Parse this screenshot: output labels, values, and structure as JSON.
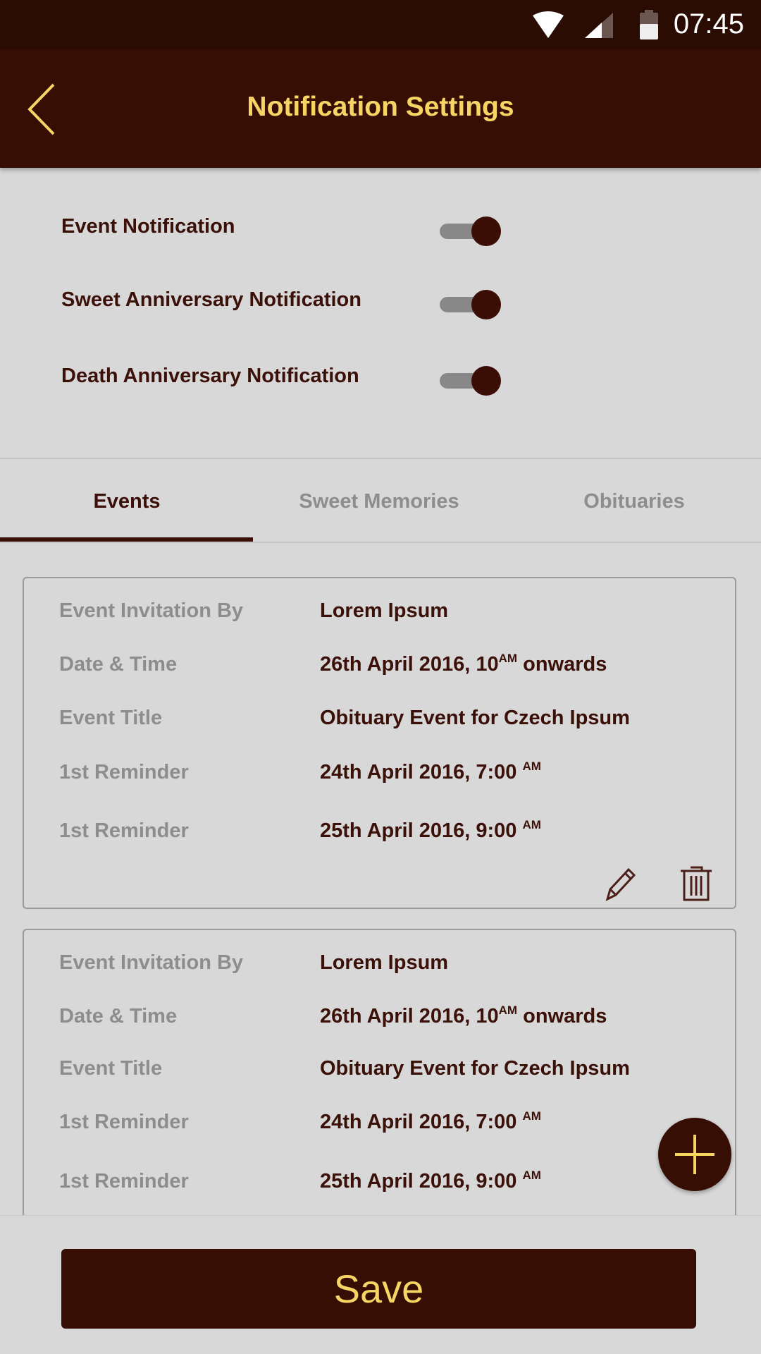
{
  "status_bar": {
    "time": "07:45"
  },
  "header": {
    "title": "Notification Settings"
  },
  "toggles": [
    {
      "label": "Event Notification",
      "on": true
    },
    {
      "label": "Sweet Anniversary Notification",
      "on": true
    },
    {
      "label": "Death Anniversary Notification",
      "on": true
    }
  ],
  "tabs": [
    {
      "label": "Events",
      "active": true
    },
    {
      "label": "Sweet Memories"
    },
    {
      "label": "Obituaries"
    }
  ],
  "cards": [
    {
      "rows": [
        {
          "k": "Event Invitation By",
          "v": "Lorem Ipsum"
        },
        {
          "k": "Date & Time",
          "v": "26th April 2016, 10",
          "sup": "AM",
          "after": " onwards"
        },
        {
          "k": "Event Title",
          "v": "Obituary Event for Czech Ipsum"
        },
        {
          "k": "1st Reminder",
          "v": "24th April 2016, 7:00 ",
          "sup": "AM"
        },
        {
          "k": "1st Reminder",
          "v": "25th April 2016, 9:00 ",
          "sup": "AM"
        }
      ]
    },
    {
      "rows": [
        {
          "k": "Event Invitation By",
          "v": "Lorem Ipsum"
        },
        {
          "k": "Date & Time",
          "v": "26th April 2016, 10",
          "sup": "AM",
          "after": " onwards"
        },
        {
          "k": "Event Title",
          "v": "Obituary Event for Czech Ipsum"
        },
        {
          "k": "1st Reminder",
          "v": "24th April 2016, 7:00 ",
          "sup": "AM"
        },
        {
          "k": "1st Reminder",
          "v": "25th April 2016, 9:00 ",
          "sup": "AM"
        }
      ]
    }
  ],
  "save_label": "Save",
  "colors": {
    "primary": "#360e04",
    "accent": "#f6d565"
  }
}
